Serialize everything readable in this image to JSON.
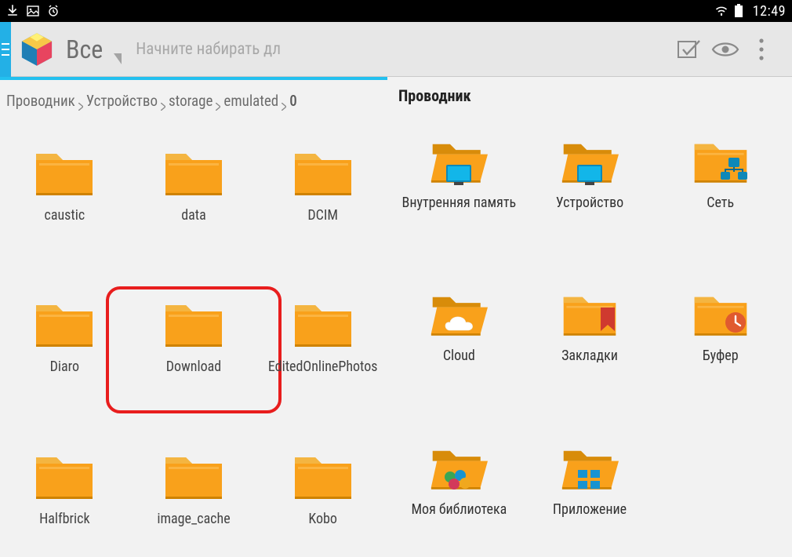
{
  "statusbar": {
    "time": "12:49"
  },
  "toolbar": {
    "title": "Все",
    "search_placeholder": "Начните набирать дл"
  },
  "left_pane": {
    "breadcrumb": [
      "Проводник",
      "Устройство",
      "storage",
      "emulated",
      "0"
    ],
    "highlighted": "Download",
    "folders": [
      {
        "label": "caustic"
      },
      {
        "label": "data"
      },
      {
        "label": "DCIM"
      },
      {
        "label": "Diaro"
      },
      {
        "label": "Download"
      },
      {
        "label": "EditedOnlinePhotos"
      },
      {
        "label": "Halfbrick"
      },
      {
        "label": "image_cache"
      },
      {
        "label": "Kobo"
      }
    ]
  },
  "right_pane": {
    "title": "Проводник",
    "folders": [
      {
        "label": "Внутренняя память",
        "icon": "memory"
      },
      {
        "label": "Устройство",
        "icon": "device"
      },
      {
        "label": "Сеть",
        "icon": "network"
      },
      {
        "label": "Cloud",
        "icon": "cloud"
      },
      {
        "label": "Закладки",
        "icon": "bookmark"
      },
      {
        "label": "Буфер",
        "icon": "clock"
      },
      {
        "label": "Моя библиотека",
        "icon": "library"
      },
      {
        "label": "Приложение",
        "icon": "apps"
      }
    ]
  }
}
